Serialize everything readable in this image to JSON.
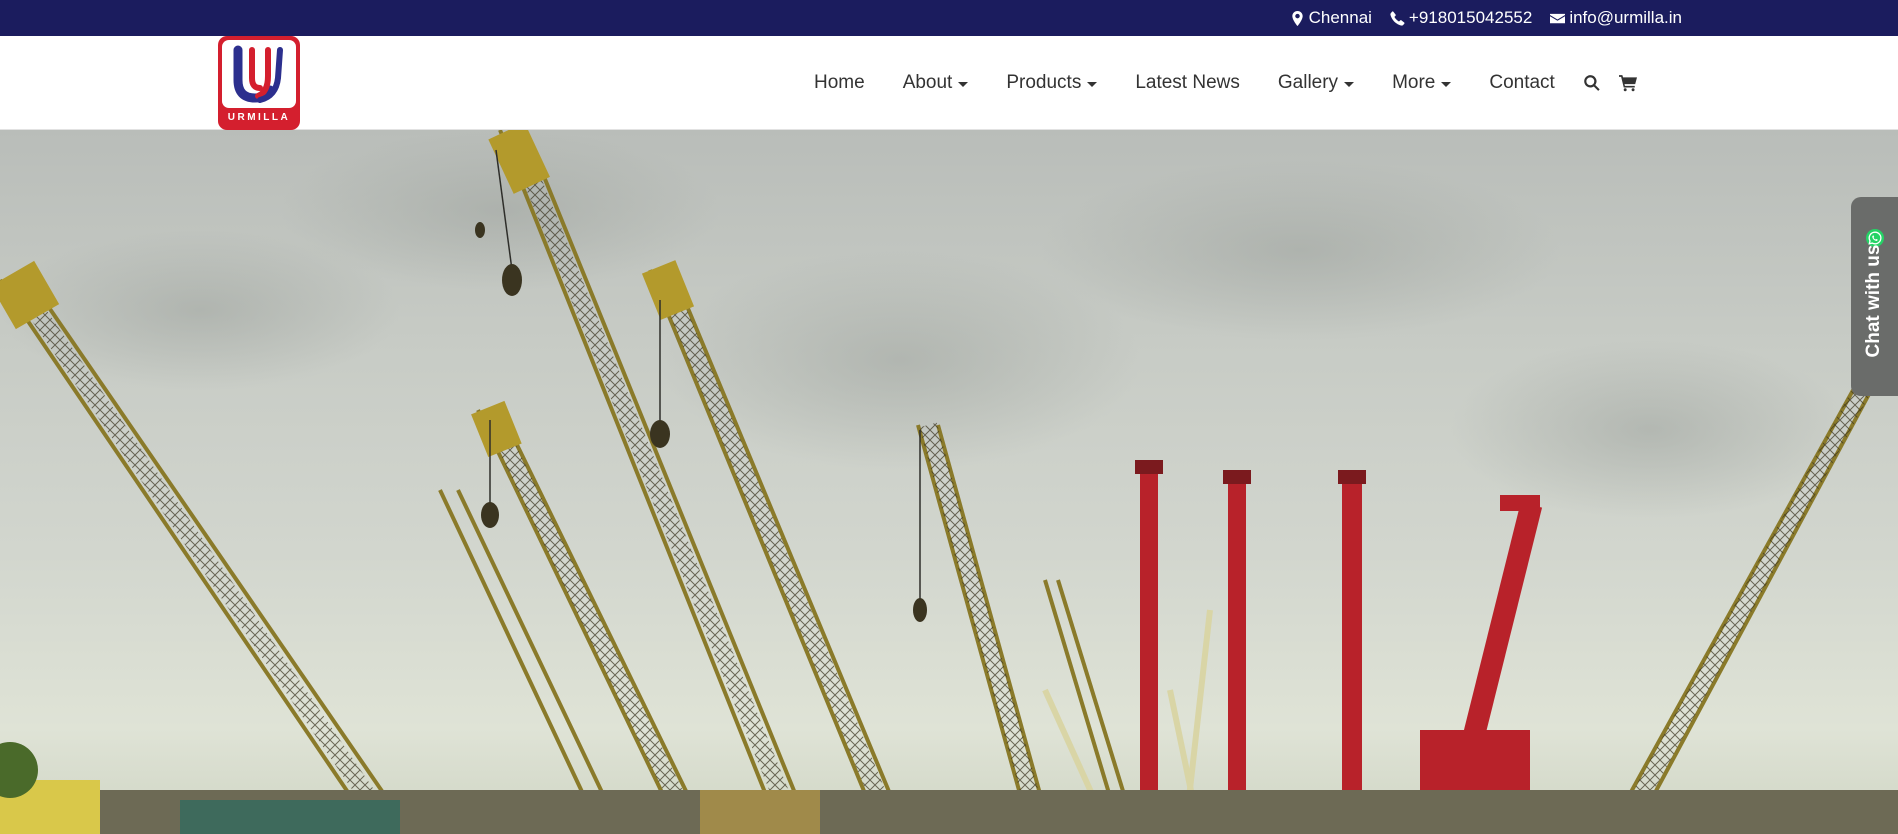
{
  "topbar": {
    "location": "Chennai",
    "phone": "+918015042552",
    "email": "info@urmilla.in"
  },
  "logo": {
    "letter": "U",
    "word": "URMILLA"
  },
  "nav": {
    "items": [
      {
        "label": "Home"
      },
      {
        "label": "About"
      },
      {
        "label": "Products"
      },
      {
        "label": "Latest News"
      },
      {
        "label": "Gallery"
      },
      {
        "label": "More"
      },
      {
        "label": "Contact"
      }
    ]
  },
  "chat": {
    "label": "Chat with us"
  },
  "colors": {
    "topbar_bg": "#1b1c5e",
    "brand_red": "#d41f2e",
    "brand_blue": "#2c2f8e",
    "whatsapp_green": "#25d366"
  },
  "icons": [
    "map-marker-icon",
    "phone-icon",
    "envelope-icon",
    "search-icon",
    "cart-icon",
    "whatsapp-icon"
  ]
}
